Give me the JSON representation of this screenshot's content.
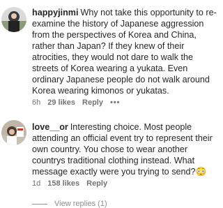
{
  "comments": [
    {
      "username": "happyjinmi",
      "text": "Why not take this opportunity to re-examine the history of Japanese aggression from the perspectives of Korea and China, rather than Japan? If they knew of their atrocities, they would not dare to walk the streets of Korea wearing a yukata. Even ordinary Japanese people do not walk around Korea wearing kimonos or yukatas.",
      "time": "6h",
      "likes": "29 likes",
      "reply": "Reply",
      "more": "•••"
    },
    {
      "username": "love__or",
      "text": "Interesting choice. Most people attending an official event try to represent their own country. You chose to wear another countrys traditional clothing instead. What message exactly were you trying to send?😳",
      "time": "1d",
      "likes": "158 likes",
      "reply": "Reply"
    }
  ],
  "view_replies": "View replies (1)",
  "icons": {
    "avatar_1": "profile-photo",
    "avatar_2": "profile-photo",
    "more": "more-options-icon"
  }
}
